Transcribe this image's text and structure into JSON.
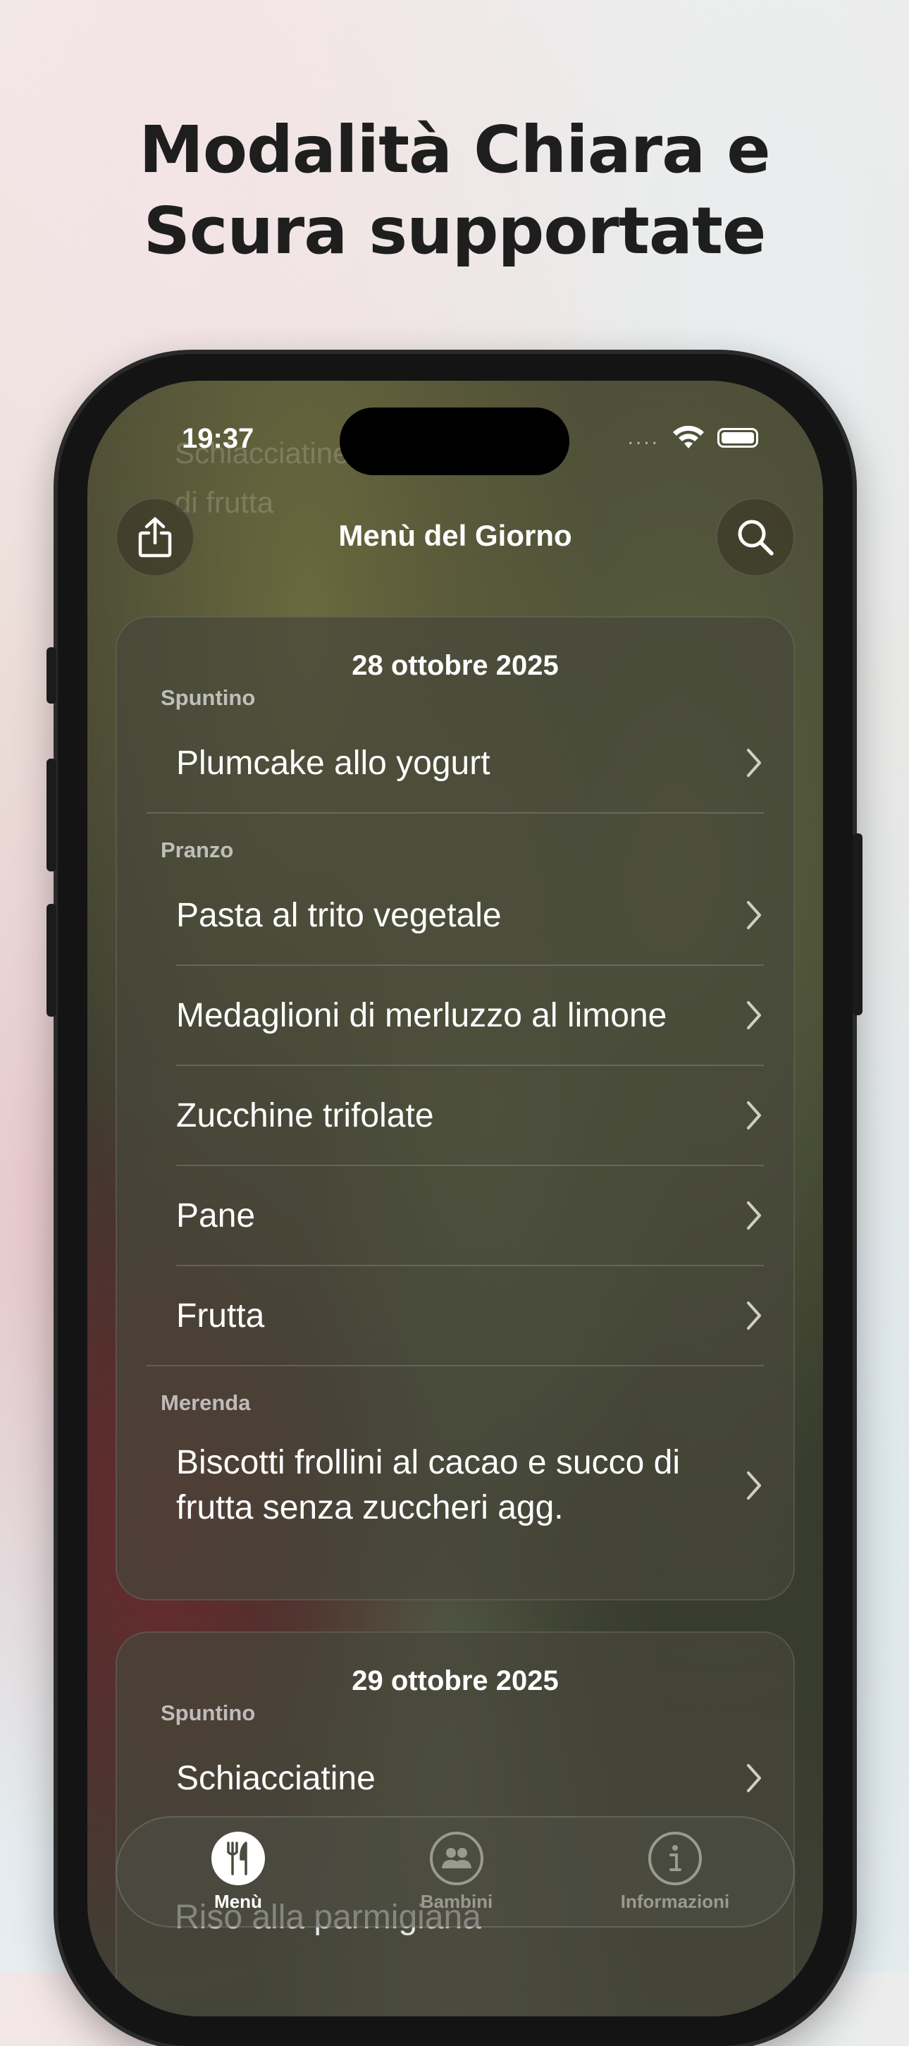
{
  "headline": {
    "line1": "Modalità Chiara e",
    "line2": "Scura supportate"
  },
  "status_bar": {
    "time": "19:37",
    "cellular": "....",
    "icons": [
      "wifi-icon",
      "battery-icon"
    ]
  },
  "background_text": {
    "line1": "Schiacciatine",
    "line2": "di frutta"
  },
  "navbar": {
    "title": "Menù del Giorno",
    "left_icon": "share-icon",
    "right_icon": "search-icon"
  },
  "days": [
    {
      "date": "28 ottobre 2025",
      "sections": [
        {
          "label": "Spuntino",
          "items": [
            "Plumcake allo yogurt"
          ]
        },
        {
          "label": "Pranzo",
          "items": [
            "Pasta al trito vegetale",
            "Medaglioni di merluzzo al limone",
            "Zucchine trifolate",
            "Pane",
            "Frutta"
          ]
        },
        {
          "label": "Merenda",
          "items": [
            "Biscotti frollini al cacao e succo di frutta senza zuccheri agg."
          ]
        }
      ]
    },
    {
      "date": "29 ottobre 2025",
      "sections": [
        {
          "label": "Spuntino",
          "items": [
            "Schiacciatine"
          ]
        },
        {
          "label": "",
          "items": [
            "Riso alla parmigiana"
          ]
        }
      ]
    }
  ],
  "tabbar": {
    "tabs": [
      {
        "label": "Menù",
        "icon": "fork-knife-icon",
        "active": true
      },
      {
        "label": "Bambini",
        "icon": "people-icon",
        "active": false
      },
      {
        "label": "Informazioni",
        "icon": "info-icon",
        "active": false
      }
    ]
  },
  "colors": {
    "accent": "#ffffff",
    "headline": "#1e1e1e",
    "inactive_tab": "#9a9a8e"
  }
}
